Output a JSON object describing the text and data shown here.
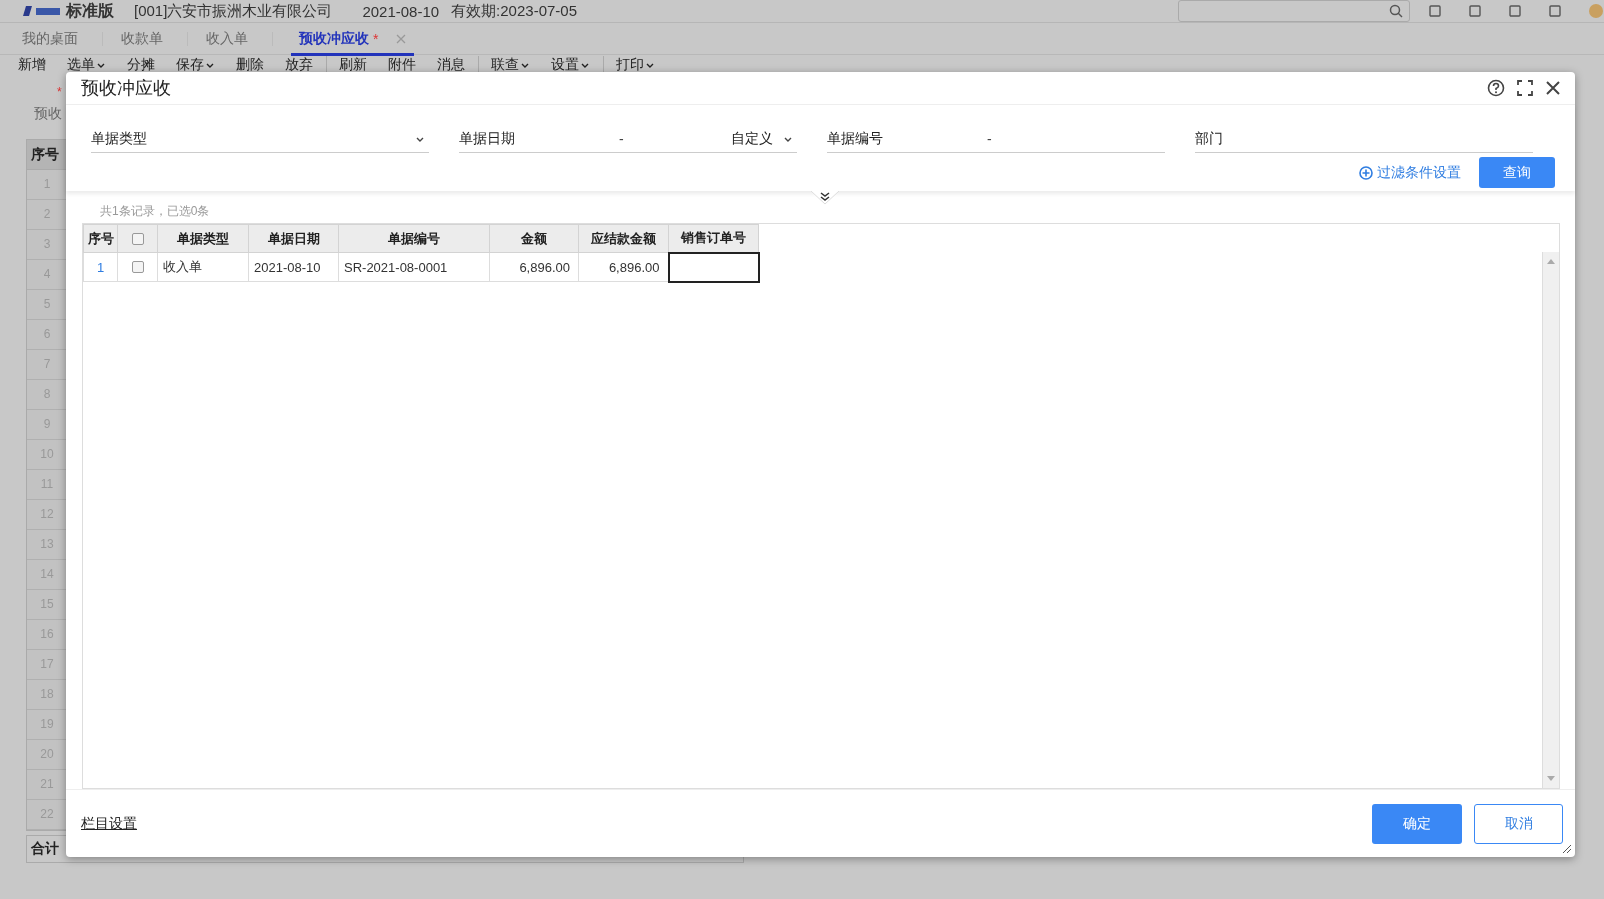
{
  "app_header": {
    "edition": "标准版",
    "company": "[001]六安市振洲木业有限公司",
    "date": "2021-08-10",
    "expiry": "有效期:2023-07-05"
  },
  "tabs": [
    {
      "label": "我的桌面",
      "selected": false,
      "modified": false,
      "closable": false
    },
    {
      "label": "收款单",
      "selected": false,
      "modified": false,
      "closable": false
    },
    {
      "label": "收入单",
      "selected": false,
      "modified": false,
      "closable": false
    },
    {
      "label": "预收冲应收",
      "selected": true,
      "modified": true,
      "closable": true
    }
  ],
  "modified_mark": "*",
  "toolbar": [
    {
      "label": "新增",
      "dropdown": false,
      "separator_before": false
    },
    {
      "label": "选单",
      "dropdown": true,
      "separator_before": false
    },
    {
      "label": "分摊",
      "dropdown": false,
      "separator_before": false
    },
    {
      "label": "保存",
      "dropdown": true,
      "separator_before": false
    },
    {
      "label": "删除",
      "dropdown": false,
      "separator_before": false
    },
    {
      "label": "放弃",
      "dropdown": false,
      "separator_before": false
    },
    {
      "label": "刷新",
      "dropdown": false,
      "separator_before": true
    },
    {
      "label": "附件",
      "dropdown": false,
      "separator_before": false
    },
    {
      "label": "消息",
      "dropdown": false,
      "separator_before": false
    },
    {
      "label": "联查",
      "dropdown": true,
      "separator_before": true
    },
    {
      "label": "设置",
      "dropdown": true,
      "separator_before": false
    },
    {
      "label": "打印",
      "dropdown": true,
      "separator_before": true
    }
  ],
  "form": {
    "required_mark": "*",
    "label": "预收",
    "grid_header": "序号",
    "row_numbers": [
      "1",
      "2",
      "3",
      "4",
      "5",
      "6",
      "7",
      "8",
      "9",
      "10",
      "11",
      "12",
      "13",
      "14",
      "15",
      "16",
      "17",
      "18",
      "19",
      "20",
      "21",
      "22"
    ],
    "total_label": "合计"
  },
  "dialog": {
    "title": "预收冲应收",
    "filters": [
      {
        "kind": "select",
        "label": "单据类型"
      },
      {
        "kind": "date_range",
        "label": "单据日期",
        "separator": "-",
        "mode": "自定义"
      },
      {
        "kind": "range",
        "label": "单据编号",
        "separator": "-"
      },
      {
        "kind": "text",
        "label": "部门"
      }
    ],
    "filter_settings": "过滤条件设置",
    "query_button": "查询",
    "summary": "共1条记录，已选0条",
    "columns": [
      {
        "kind": "index",
        "label": "序号"
      },
      {
        "kind": "checkbox",
        "checked": false
      },
      {
        "kind": "text",
        "label": "单据类型"
      },
      {
        "kind": "text",
        "label": "单据日期"
      },
      {
        "kind": "text",
        "label": "单据编号"
      },
      {
        "kind": "number",
        "label": "金额"
      },
      {
        "kind": "number",
        "label": "应结款金额"
      },
      {
        "kind": "text",
        "label": "销售订单号"
      }
    ],
    "rows": [
      {
        "checked": false,
        "cells": [
          "1",
          "",
          "收入单",
          "2021-08-10",
          "SR-2021-08-0001",
          "6,896.00",
          "6,896.00",
          ""
        ],
        "editing_last": true
      }
    ],
    "column_settings": "栏目设置",
    "ok_button": "确定",
    "cancel_button": "取消"
  }
}
